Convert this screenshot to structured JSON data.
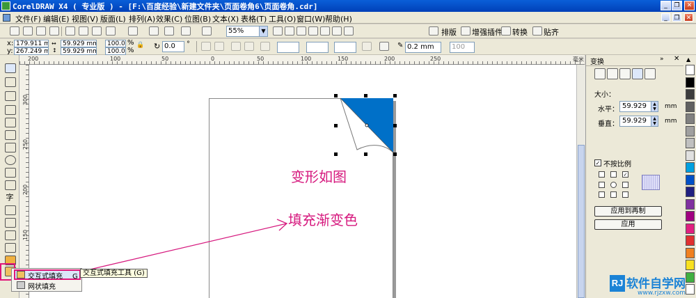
{
  "window": {
    "title": "CorelDRAW X4 ( 专业版 ) - [F:\\百度经验\\新建文件夹\\页面卷角6\\页面卷角.cdr]",
    "buttons": {
      "minimize": "_",
      "restore": "❐",
      "close": "✕"
    }
  },
  "menu": {
    "items": [
      "文件(F)",
      "编辑(E)",
      "视图(V)",
      "版面(L)",
      "排列(A)",
      "效果(C)",
      "位图(B)",
      "文本(X)",
      "表格(T)",
      "工具(O)",
      "窗口(W)",
      "帮助(H)"
    ],
    "doc_buttons": {
      "minimize": "_",
      "restore": "❐",
      "close": "✕"
    }
  },
  "standard_toolbar": {
    "zoom": "55%",
    "text_buttons": [
      "排版",
      "增强插件",
      "转换",
      "贴齐"
    ]
  },
  "property_bar": {
    "x_label": "x:",
    "x": "179.911 mm",
    "y_label": "y:",
    "y": "267.249 mm",
    "width": "59.929 mm",
    "height": "59.929 mm",
    "scale_x": "100.0",
    "scale_y": "100.0",
    "percent": "%",
    "rotation": "0.0",
    "degree": "°",
    "outline_width": "0.2 mm",
    "extra_value": "100"
  },
  "rulers": {
    "top_labels": [
      "200",
      "100",
      "50",
      "0",
      "50",
      "100",
      "150",
      "200",
      "250"
    ],
    "unit": "毫米",
    "left_labels": [
      "300",
      "250",
      "200",
      "150"
    ]
  },
  "canvas": {
    "annotation_1": "变形如图",
    "annotation_2": "填充渐变色",
    "fill_color": "#0070c8"
  },
  "flyout": {
    "items": [
      {
        "label": "交互式填充",
        "shortcut": "G"
      },
      {
        "label": "网状填充",
        "shortcut": ""
      }
    ],
    "tooltip": "交互式填充工具 (G)"
  },
  "docker": {
    "title": "变换",
    "size_label": "大小：",
    "horizontal_label": "水平：",
    "horizontal_value": "59.929",
    "horizontal_unit": "mm",
    "vertical_label": "垂直：",
    "vertical_value": "59.929",
    "vertical_unit": "mm",
    "nonproportional_label": "不按比例",
    "apply_copy_label": "应用到再制",
    "apply_label": "应用"
  },
  "palette": {
    "colors": [
      "#ffffff",
      "#000000",
      "#3c3c3c",
      "#606060",
      "#808080",
      "#a0a0a0",
      "#c0c0c0",
      "#e0e0e0",
      "#00a0e0",
      "#0050c8",
      "#202080",
      "#8030a0",
      "#a00080",
      "#e02080",
      "#e03030",
      "#f08020",
      "#f8e020",
      "#40b040",
      "#ffffff"
    ]
  },
  "watermark": {
    "brand": "软件自学网",
    "url": "www.rjzxw.com",
    "logo_letters": "RJ"
  }
}
